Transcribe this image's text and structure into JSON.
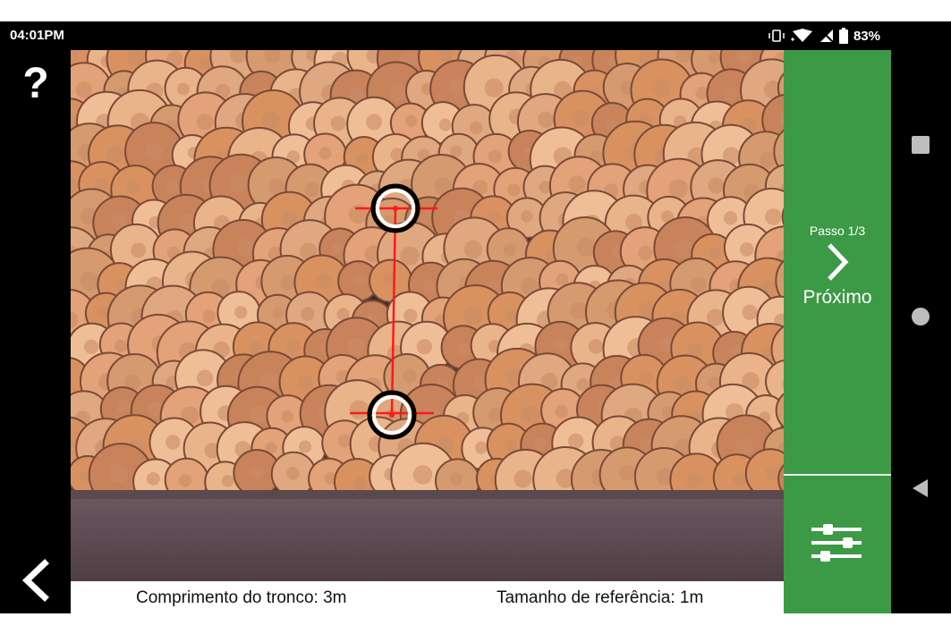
{
  "status_bar": {
    "time": "04:01PM",
    "battery": "83%",
    "icons": [
      "vibrate-icon",
      "wifi-icon",
      "no-sim-icon",
      "battery-icon"
    ]
  },
  "toolbar": {
    "help_label": "?",
    "back_icon": "chevron-left-icon"
  },
  "photo": {
    "description_icon": "log-pile-photo",
    "measure_line_color": "#ff1a1a"
  },
  "caption": {
    "log_length": "Comprimento do tronco: 3m",
    "reference_size": "Tamanho de referência: 1m"
  },
  "panel": {
    "step": "Passo 1/3",
    "next_label": "Próximo",
    "settings_icon": "sliders-icon",
    "accent": "#3c9a46"
  },
  "system_nav": [
    "recents-icon",
    "home-icon",
    "back-icon"
  ]
}
